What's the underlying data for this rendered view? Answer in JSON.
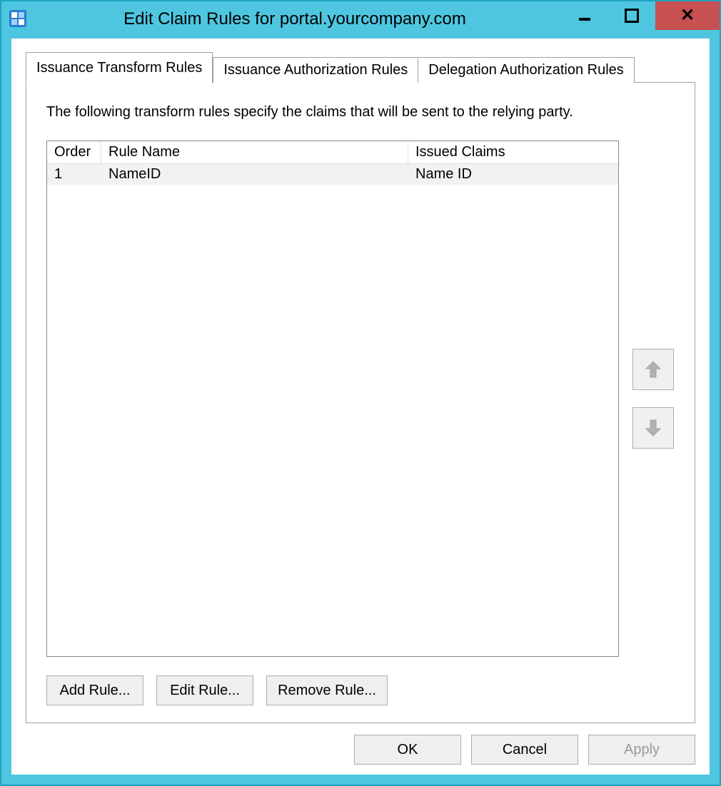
{
  "window": {
    "title": "Edit Claim Rules for portal.yourcompany.com"
  },
  "tabs": [
    {
      "label": "Issuance Transform Rules",
      "active": true
    },
    {
      "label": "Issuance Authorization Rules",
      "active": false
    },
    {
      "label": "Delegation Authorization Rules",
      "active": false
    }
  ],
  "description": "The following transform rules specify the claims that will be sent to the relying party.",
  "columns": {
    "order": "Order",
    "ruleName": "Rule Name",
    "issuedClaims": "Issued Claims"
  },
  "rules": [
    {
      "order": "1",
      "name": "NameID",
      "issuedClaims": "Name ID"
    }
  ],
  "ruleButtons": {
    "add": "Add Rule...",
    "edit": "Edit Rule...",
    "remove": "Remove Rule..."
  },
  "dialogButtons": {
    "ok": "OK",
    "cancel": "Cancel",
    "apply": "Apply"
  }
}
